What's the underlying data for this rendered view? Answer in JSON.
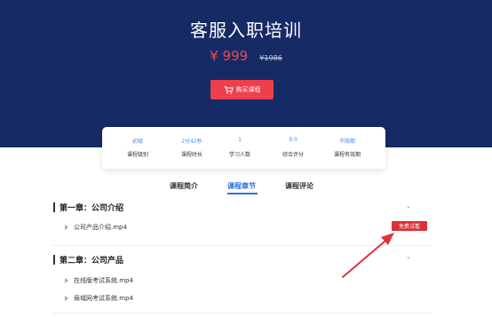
{
  "hero": {
    "title": "客服入职培训",
    "price": "¥ 999",
    "original_price": "¥1986",
    "buy_label": "购买课程",
    "background_color": "#162a66",
    "buy_button_color": "#ef3f4b",
    "cart_icon": "cart-icon"
  },
  "stats": [
    {
      "value": "初级",
      "label": "课程级别"
    },
    {
      "value": "2分42秒",
      "label": "课程时长"
    },
    {
      "value": "1",
      "label": "学习人数"
    },
    {
      "value": "9.0",
      "label": "综合评分"
    },
    {
      "value": "不限期",
      "label": "课程有效期"
    }
  ],
  "tabs": {
    "items": [
      "课程简介",
      "课程章节",
      "课程评论"
    ],
    "active": "课程章节",
    "accent_color": "#2f6ee0"
  },
  "chapters": [
    {
      "title": "第一章：公司介绍",
      "lessons": [
        {
          "name": "公司产品介绍.mp4",
          "badge": "免费试看"
        }
      ]
    },
    {
      "title": "第二章：公司产品",
      "lessons": [
        {
          "name": "在线版考试系统.mp4"
        },
        {
          "name": "局域网考试系统.mp4"
        }
      ]
    }
  ],
  "annotation": {
    "arrow_color": "#e0333b"
  }
}
